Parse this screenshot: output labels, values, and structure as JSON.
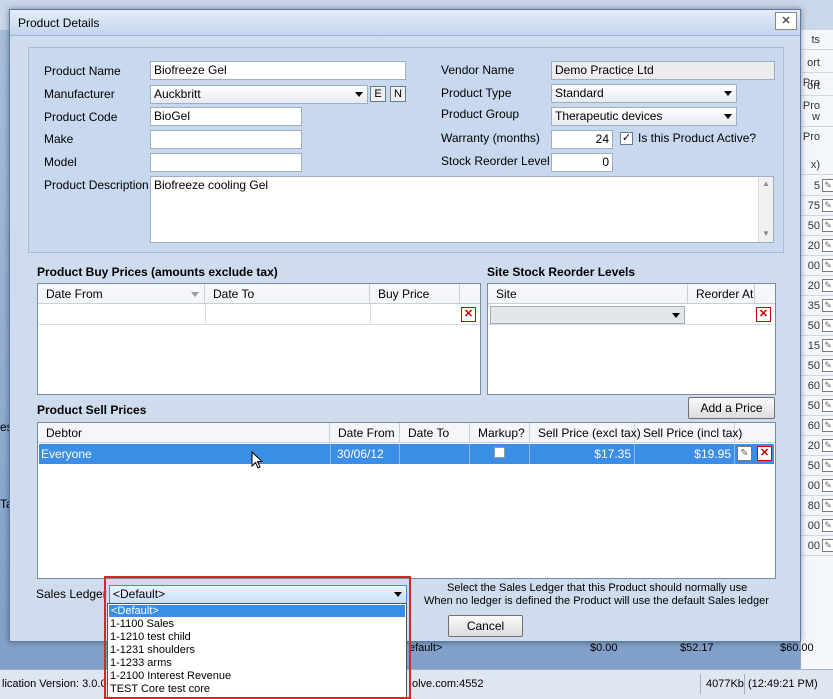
{
  "dialog": {
    "title": "Product Details",
    "close_label": "✕"
  },
  "form": {
    "product_name_label": "Product Name",
    "product_name_value": "Biofreeze Gel",
    "manufacturer_label": "Manufacturer",
    "manufacturer_value": "Auckbritt",
    "manufacturer_edit_label": "E",
    "manufacturer_new_label": "N",
    "product_code_label": "Product Code",
    "product_code_value": "BioGel",
    "make_label": "Make",
    "make_value": "",
    "model_label": "Model",
    "model_value": "",
    "product_description_label": "Product Description",
    "product_description_value": "Biofreeze cooling Gel",
    "vendor_name_label": "Vendor Name",
    "vendor_name_value": "Demo Practice Ltd",
    "product_type_label": "Product Type",
    "product_type_value": "Standard",
    "product_group_label": "Product Group",
    "product_group_value": "Therapeutic devices",
    "warranty_label": "Warranty (months)",
    "warranty_value": "24",
    "active_label": "Is this Product Active?",
    "active_checked": true,
    "stock_reorder_label": "Stock Reorder Level",
    "stock_reorder_value": "0"
  },
  "buy_prices": {
    "title": "Product Buy Prices (amounts exclude tax)",
    "columns": [
      "Date From",
      "Date To",
      "Buy Price"
    ],
    "rows": []
  },
  "site_stock": {
    "title": "Site Stock Reorder Levels",
    "columns": [
      "Site",
      "Reorder At"
    ],
    "rows": []
  },
  "sell_prices": {
    "title": "Product Sell Prices",
    "add_button": "Add a Price",
    "columns": [
      "Debtor",
      "Date From",
      "Date To",
      "Markup?",
      "Sell Price (excl tax)",
      "Sell Price (incl tax)"
    ],
    "rows": [
      {
        "debtor": "Everyone",
        "date_from": "30/06/12",
        "date_to": "",
        "markup": false,
        "sell_excl": "$17.35",
        "sell_incl": "$19.95"
      }
    ]
  },
  "sales_ledger": {
    "label": "Sales Ledger",
    "value": "<Default>",
    "hint_line1": "Select the Sales Ledger that this Product should normally use",
    "hint_line2": "When no ledger is defined the Product will use the default Sales ledger",
    "options": [
      "<Default>",
      "1-1100 Sales",
      "1-1210 test child",
      "1-1231 shoulders",
      "1-1233 arms",
      "1-2100 Interest Revenue",
      "TEST Core test core"
    ]
  },
  "cancel_button": "Cancel",
  "background": {
    "right_values": [
      "ts",
      "ort Pro",
      "ort Pro",
      "w Pro",
      "x)",
      "5",
      "75",
      "50",
      "20",
      "00",
      "20",
      "35",
      "50",
      "15",
      "50",
      "60",
      "50",
      "60",
      "20",
      "50",
      "00",
      "80",
      "00",
      "00"
    ],
    "left_fragments": [
      "es",
      "Ta"
    ],
    "ledger_fragment": "efault>",
    "amount1": "$0.00",
    "amount2": "$52.17",
    "amount3": "$60.00"
  },
  "status_bar": {
    "version": "lication Version: 3.0.0",
    "host": "olve.com:4552",
    "memory": "4077Kb",
    "time": "(12:49:21 PM)"
  },
  "colors": {
    "selection": "#3b8ee6",
    "highlight_border": "#d8262a",
    "delete_icon": "#cc0000"
  }
}
